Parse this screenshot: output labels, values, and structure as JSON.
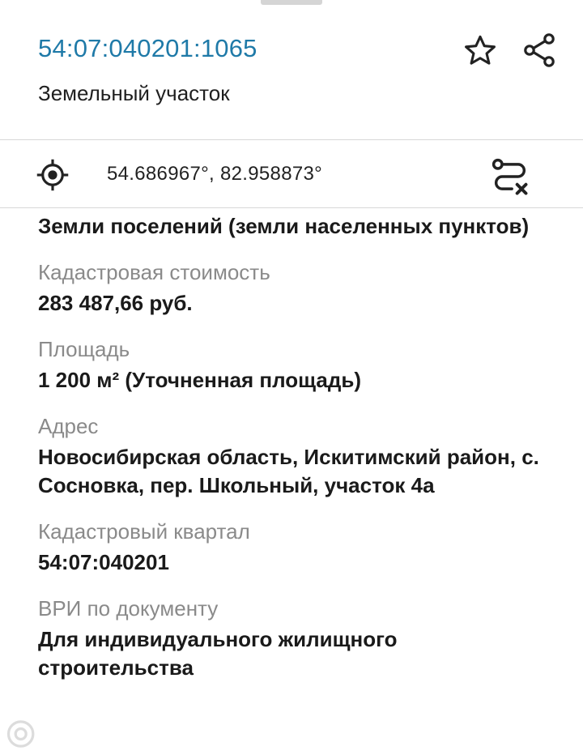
{
  "header": {
    "cadastral_number": "54:07:040201:1065",
    "object_type": "Земельный участок"
  },
  "icons": {
    "favorite": "star-icon",
    "share": "share-icon",
    "locate": "crosshair-icon",
    "route": "route-icon"
  },
  "coordinates": {
    "text": "54.686967°, 82.958873°"
  },
  "land_category": "Земли поселений (земли населенных пунктов)",
  "fields": [
    {
      "label": "Кадастровая стоимость",
      "value": "283 487,66 руб."
    },
    {
      "label": "Площадь",
      "value": "1 200 м² (Уточненная площадь)"
    },
    {
      "label": "Адрес",
      "value": "Новосибирская область, Искитимский район, с. Сосновка, пер. Школьный, участок 4а"
    },
    {
      "label": "Кадастровый квартал",
      "value": "54:07:040201"
    },
    {
      "label": "ВРИ по документу",
      "value": "Для индивидуального жилищного строительства"
    }
  ],
  "colors": {
    "link": "#1f7aa8",
    "label": "#8a8a8a",
    "text": "#1a1a1a"
  }
}
